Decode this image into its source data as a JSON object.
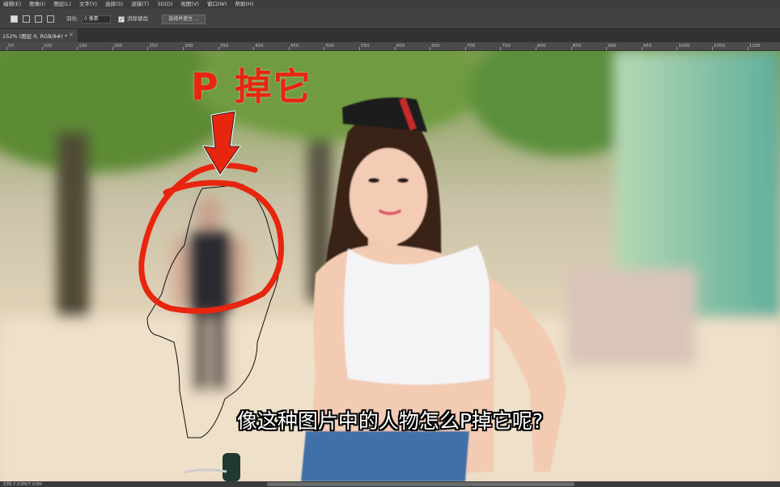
{
  "menubar": {
    "items": [
      "编辑(E)",
      "图像(I)",
      "图层(L)",
      "文字(Y)",
      "选择(S)",
      "滤镜(T)",
      "3D(D)",
      "视图(V)",
      "窗口(W)",
      "帮助(H)"
    ]
  },
  "options": {
    "feather_label": "羽化:",
    "feather_value": "0 像素",
    "antialias_label": "消除锯齿",
    "select_mask_button": "选择并遮住 ..."
  },
  "document_tab": {
    "title": "152% (图层 0, RGB/8#) *",
    "close": "×"
  },
  "ruler": {
    "ticks": [
      "50",
      "100",
      "150",
      "200",
      "250",
      "300",
      "350",
      "400",
      "450",
      "500",
      "550",
      "600",
      "650",
      "700",
      "750",
      "800",
      "850",
      "900",
      "950",
      "1000",
      "1050",
      "1100"
    ]
  },
  "annotation": {
    "text": "P 掉它",
    "color": "#e8250f"
  },
  "caption": {
    "text": "像这种图片中的人物怎么P掉它呢?"
  },
  "statusbar": {
    "text": "文档:7.03M/7.03M"
  },
  "colors": {
    "annotation_red": "#e8250f",
    "ps_panel": "#424242",
    "ps_menubar": "#3c3c3c"
  }
}
